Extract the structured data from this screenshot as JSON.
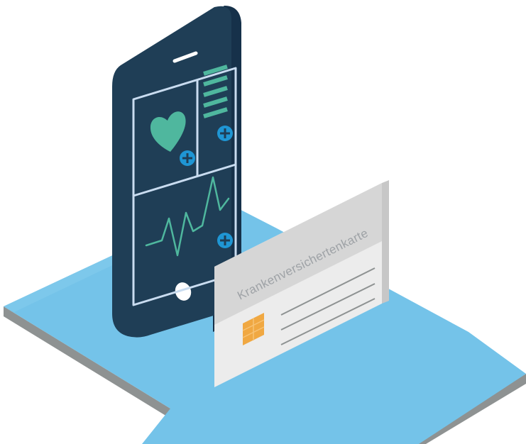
{
  "colors": {
    "platform_top": "#74c3e9",
    "platform_side": "#8e9292",
    "phone_body": "#1f3e56",
    "phone_edge": "#16314a",
    "screen_lines": "#c9dcf0",
    "heart": "#4fb79e",
    "plus_button": "#1f96d4",
    "card_face": "#ececec",
    "card_header": "#d6d6d6",
    "card_edge": "#c7c7c7",
    "chip": "#f0a842",
    "home_button": "#ffffff"
  },
  "icons": {
    "heart": "heart-icon",
    "pulse": "heartbeat-line-icon",
    "document": "document-lines-icon",
    "add": "plus-circle-icon",
    "chip": "smartcard-chip-icon"
  },
  "card": {
    "title": "Krankenversichertenkarte"
  }
}
